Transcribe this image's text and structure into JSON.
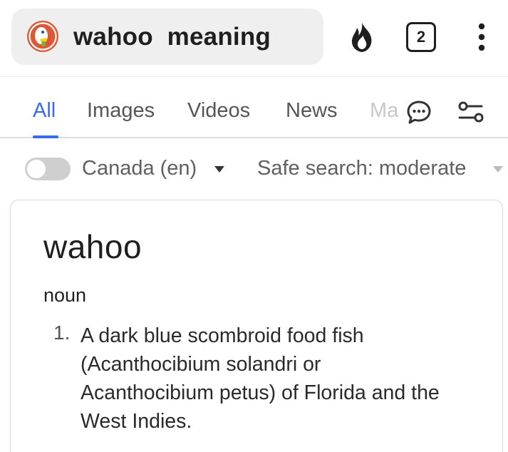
{
  "search": {
    "query": "wahoo  meaning",
    "tab_count": "2"
  },
  "nav": {
    "tabs": [
      {
        "label": "All",
        "active": true
      },
      {
        "label": "Images"
      },
      {
        "label": "Videos"
      },
      {
        "label": "News"
      },
      {
        "label": "Maps"
      }
    ]
  },
  "filters": {
    "region": "Canada (en)",
    "safe_search": "Safe search: moderate"
  },
  "definition": {
    "word": "wahoo",
    "part_of_speech": "noun",
    "entries": [
      {
        "number": "1.",
        "text": "A dark blue scombroid food fish (Acanthocibium solandri or Acanthocibium petus) of Florida and the West Indies."
      }
    ]
  },
  "colors": {
    "accent": "#3969ef",
    "logo_orange": "#de5833"
  },
  "icons": [
    "duckduckgo-logo-icon",
    "fire-icon",
    "tabs-icon",
    "more-vertical-icon",
    "chat-icon",
    "settings-sliders-icon",
    "dropdown-caret-icon"
  ]
}
